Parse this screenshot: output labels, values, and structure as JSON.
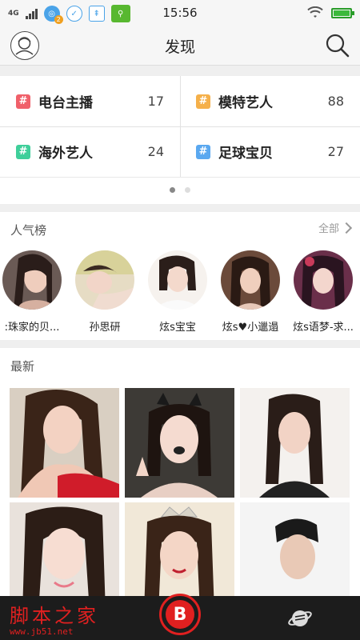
{
  "status_bar": {
    "network": "4G",
    "notification_badge": "2",
    "time": "15:56"
  },
  "header": {
    "title": "发现"
  },
  "categories": [
    {
      "name": "电台主播",
      "count": "17",
      "color": "#f0606a"
    },
    {
      "name": "模特艺人",
      "count": "88",
      "color": "#f5b04a"
    },
    {
      "name": "海外艺人",
      "count": "24",
      "color": "#3fcf9a"
    },
    {
      "name": "足球宝贝",
      "count": "27",
      "color": "#5aa8f0"
    }
  ],
  "carousel": {
    "pages": 2,
    "active": 1
  },
  "popular": {
    "title": "人气榜",
    "all_label": "全部",
    "people": [
      {
        "name": ":珠家的贝..."
      },
      {
        "name": "孙思研"
      },
      {
        "name": "炫s宝宝"
      },
      {
        "name": "炫s♥小邋遢"
      },
      {
        "name": "炫s语梦-求..."
      }
    ]
  },
  "latest": {
    "title": "最新"
  },
  "bottom_nav": {
    "logo_letter": "B",
    "watermark_text": "脚本之家",
    "watermark_url": "www.jb51.net"
  },
  "colors": {
    "accent_red": "#e02020",
    "nav_bg": "#1c1c1c"
  }
}
